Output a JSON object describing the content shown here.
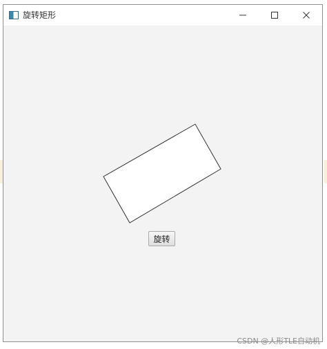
{
  "window": {
    "title": "旋转矩形",
    "icon": "app-window-icon",
    "controls": {
      "minimize_icon": "minimize-icon",
      "maximize_icon": "maximize-icon",
      "close_icon": "close-icon"
    }
  },
  "content": {
    "rotate_button_label": "旋转",
    "shape": {
      "type": "rectangle",
      "fill": "#ffffff",
      "stroke": "#333333"
    }
  },
  "watermark": {
    "text": "CSDN @人形TLE自动机"
  }
}
